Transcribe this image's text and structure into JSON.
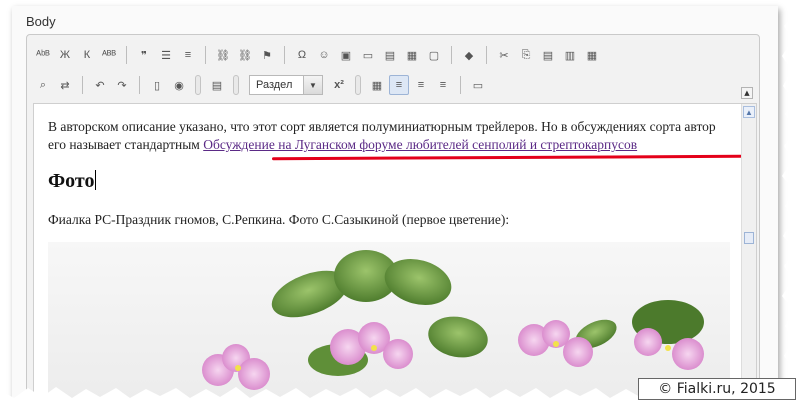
{
  "field": {
    "label": "Body"
  },
  "toolbar_row1": [
    {
      "name": "spellcheck-icon",
      "glyph": "ᴬᵇᴮ"
    },
    {
      "name": "bold-icon",
      "glyph": "Ж"
    },
    {
      "name": "italic-icon",
      "glyph": "К"
    },
    {
      "name": "strikethrough-icon",
      "glyph": "ᴬᴮᴮ"
    },
    {
      "name": "blockquote-icon",
      "glyph": "❞"
    },
    {
      "name": "bulleted-list-icon",
      "glyph": "☰"
    },
    {
      "name": "numbered-list-icon",
      "glyph": "≡"
    },
    {
      "name": "link-icon",
      "glyph": "⛓"
    },
    {
      "name": "unlink-icon",
      "glyph": "⛓"
    },
    {
      "name": "anchor-icon",
      "glyph": "⚑"
    },
    {
      "name": "special-char-icon",
      "glyph": "Ω"
    },
    {
      "name": "smiley-icon",
      "glyph": "☺"
    },
    {
      "name": "image-icon",
      "glyph": "▣"
    },
    {
      "name": "folder-icon",
      "glyph": "▭"
    },
    {
      "name": "media-icon",
      "glyph": "▤"
    },
    {
      "name": "table-icon",
      "glyph": "▦"
    },
    {
      "name": "fullscreen-icon",
      "glyph": "▢"
    },
    {
      "name": "eraser-icon",
      "glyph": "◆"
    },
    {
      "name": "cut-icon",
      "glyph": "✂"
    },
    {
      "name": "copy-icon",
      "glyph": "⎘"
    },
    {
      "name": "paste-icon",
      "glyph": "▤"
    },
    {
      "name": "paste-text-icon",
      "glyph": "▥"
    },
    {
      "name": "paste-word-icon",
      "glyph": "▦"
    }
  ],
  "toolbar_row2": {
    "find": "⌕",
    "replace": "⇄",
    "undo": "↶",
    "redo": "↷",
    "preview": "▯",
    "show-blocks": "◉",
    "template": "▤",
    "format_select": "Раздел",
    "superscript": "x²",
    "table": "▦",
    "align_left": "≡",
    "align_center": "≡",
    "align_right": "≡",
    "hr": "▭"
  },
  "content": {
    "para1_text": "В авторском описание указано, что этот сорт является полуминиатюрным трейлеров. Но в обсуждениях сорта автор его называет стандартным ",
    "para1_link": "Обсуждение на Луганском форуме любителей сенполий и стрептокарпусов",
    "heading": "Фото",
    "para2": "Фиалка РС-Праздник гномов, С.Репкина. Фото С.Сазыкиной (первое цветение):"
  },
  "watermark": "© Fialki.ru, 2015",
  "colors": {
    "link": "#5b2a86",
    "highlight": "#e4001a",
    "leaf": "#6f9d4c",
    "flower": "#e7a6d8"
  }
}
